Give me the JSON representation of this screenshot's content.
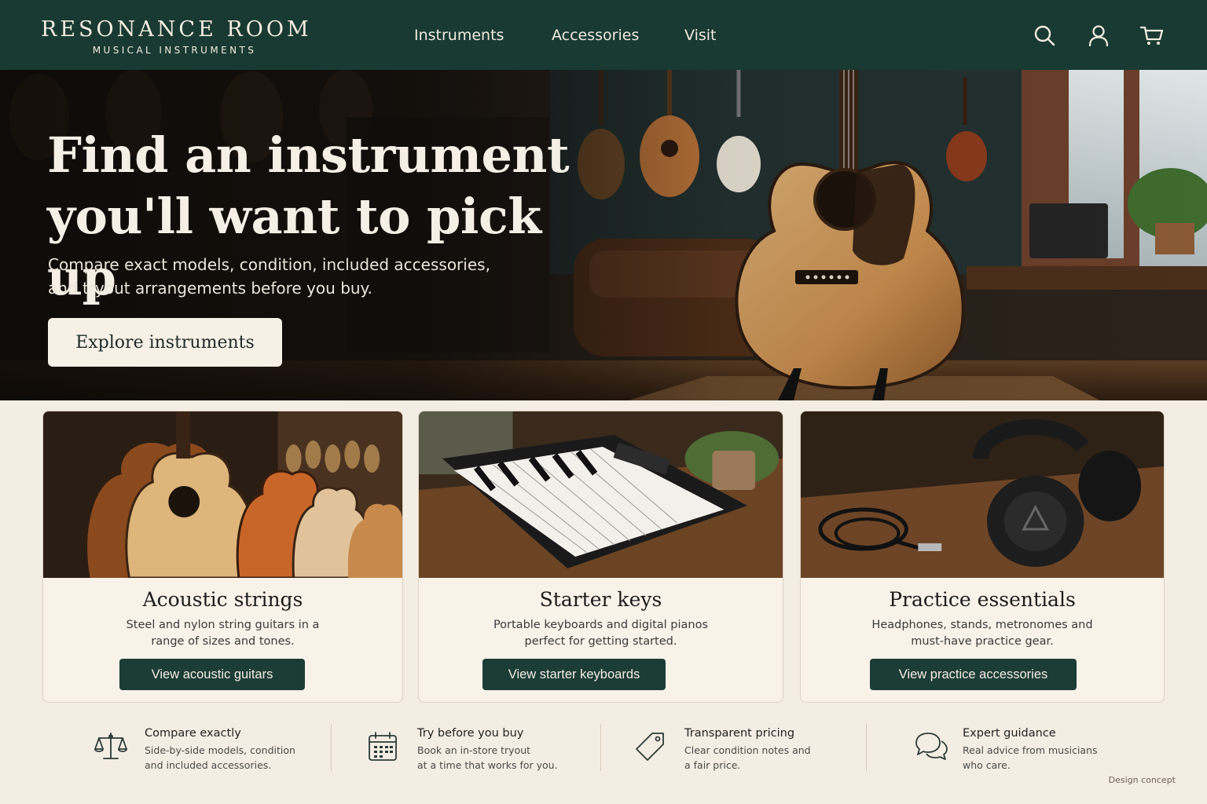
{
  "header": {
    "logo_title": "RESONANCE ROOM",
    "logo_subtitle": "MUSICAL INSTRUMENTS",
    "nav": [
      "Instruments",
      "Accessories",
      "Visit"
    ],
    "icons": [
      "search-icon",
      "account-icon",
      "cart-icon"
    ]
  },
  "hero": {
    "title_line1": "Find an instrument",
    "title_line2": "you'll want to pick up",
    "subtitle_line1": "Compare exact models, condition, included accessories,",
    "subtitle_line2": "and tryout arrangements before you buy.",
    "cta": "Explore instruments"
  },
  "cards": [
    {
      "title": "Acoustic strings",
      "desc_line1": "Steel and nylon string guitars in a",
      "desc_line2": "range of sizes and tones.",
      "button": "View acoustic guitars"
    },
    {
      "title": "Starter keys",
      "desc_line1": "Portable keyboards and digital pianos",
      "desc_line2": "perfect for getting started.",
      "button": "View starter keyboards"
    },
    {
      "title": "Practice essentials",
      "desc_line1": "Headphones, stands, metronomes and",
      "desc_line2": "must-have practice gear.",
      "button": "View practice accessories"
    }
  ],
  "features": [
    {
      "icon": "scale-icon",
      "title": "Compare exactly",
      "line1": "Side-by-side models, condition",
      "line2": "and included accessories."
    },
    {
      "icon": "calendar-icon",
      "title": "Try before you buy",
      "line1": "Book an in-store tryout",
      "line2": "at a time that works for you."
    },
    {
      "icon": "price-tag-icon",
      "title": "Transparent pricing",
      "line1": "Clear condition notes and",
      "line2": "a fair price."
    },
    {
      "icon": "chat-bubbles-icon",
      "title": "Expert guidance",
      "line1": "Real advice from musicians",
      "line2": "who care."
    }
  ],
  "footer_note": "Design concept",
  "colors": {
    "header_bg": "#183a33",
    "button_bg": "#1c3d36",
    "page_bg": "#f4ede3",
    "card_bg": "#f8f2e9"
  }
}
